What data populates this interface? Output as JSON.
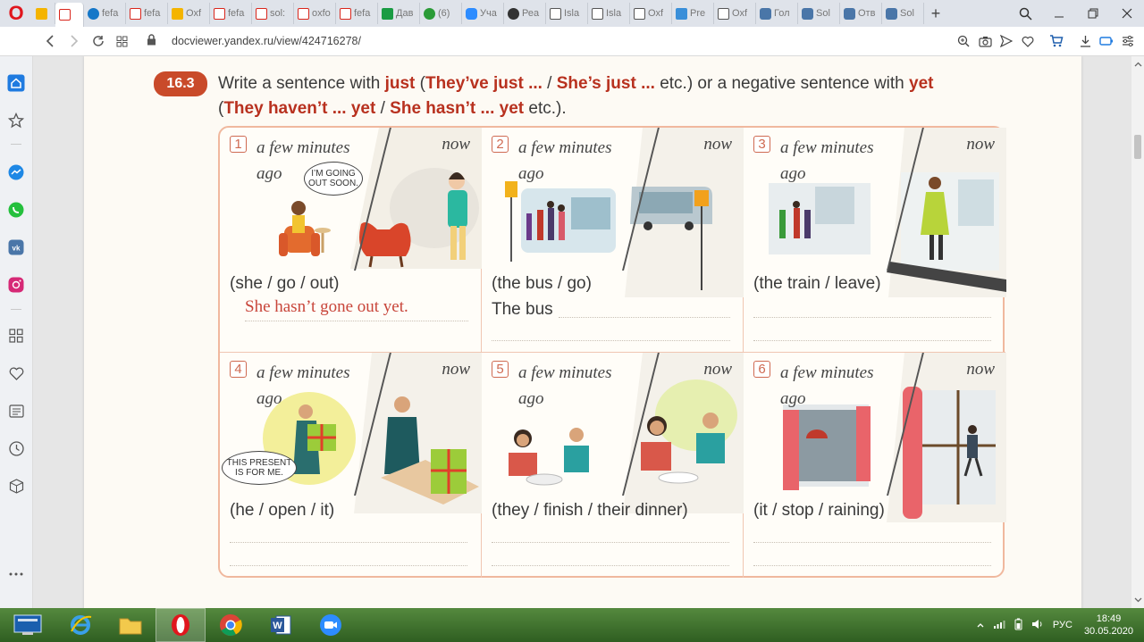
{
  "browser": {
    "tabs": [
      {
        "icon": "mail-icon",
        "label": ""
      },
      {
        "icon": "pdf-icon",
        "label": ""
      },
      {
        "icon": "edge-icon",
        "label": "fefa"
      },
      {
        "icon": "pdf-icon",
        "label": "fefa"
      },
      {
        "icon": "oxford-icon",
        "label": "Oxf"
      },
      {
        "icon": "pdf-icon",
        "label": "fefa"
      },
      {
        "icon": "pdf-icon",
        "label": "sol:"
      },
      {
        "icon": "pdf-icon",
        "label": "oxfo"
      },
      {
        "icon": "pdf-icon",
        "label": "fefa"
      },
      {
        "icon": "plus-app-icon",
        "label": "Дав"
      },
      {
        "icon": "green-circle-icon",
        "label": "(6)"
      },
      {
        "icon": "zoom-icon",
        "label": "Уча"
      },
      {
        "icon": "dark-circle-icon",
        "label": "Реа"
      },
      {
        "icon": "doc-icon",
        "label": "Isla"
      },
      {
        "icon": "doc-icon",
        "label": "Isla"
      },
      {
        "icon": "doc-icon",
        "label": "Oxf"
      },
      {
        "icon": "grid-icon",
        "label": "Pre"
      },
      {
        "icon": "doc-icon",
        "label": "Oxf"
      },
      {
        "icon": "vk-icon",
        "label": "Гол"
      },
      {
        "icon": "vk-icon",
        "label": "Sol"
      },
      {
        "icon": "vk-icon",
        "label": "Отв"
      },
      {
        "icon": "vk-icon",
        "label": "Sol"
      }
    ],
    "new_tab": "+",
    "url": "docviewer.yandex.ru/view/424716278/"
  },
  "exercise": {
    "number": "16.3",
    "instruction": {
      "p1": "Write a sentence with ",
      "just": "just",
      "p2": " (",
      "theyve_just": "They’ve just ...",
      "p3": " / ",
      "shes_just": "She’s just ...",
      "p4": " etc.) or a negative sentence with ",
      "yet": "yet",
      "p5": "(",
      "they_havent": "They haven’t ... yet",
      "p6": " / ",
      "she_hasnt": "She hasn’t ... yet",
      "p7": " etc.)."
    },
    "time_before": "a few minutes ago",
    "time_now": "now",
    "items": [
      {
        "num": "1",
        "prompt": "(she / go / out)",
        "answer": "She hasn’t gone out yet.",
        "starter": "",
        "speech": "I’M GOING OUT SOON."
      },
      {
        "num": "2",
        "prompt": "(the bus / go)",
        "answer": "",
        "starter": "The bus",
        "speech": ""
      },
      {
        "num": "3",
        "prompt": "(the train / leave)",
        "answer": "",
        "starter": "",
        "speech": ""
      },
      {
        "num": "4",
        "prompt": "(he / open / it)",
        "answer": "",
        "starter": "",
        "speech": "THIS PRESENT IS FOR ME."
      },
      {
        "num": "5",
        "prompt": "(they / finish / their dinner)",
        "answer": "",
        "starter": "",
        "speech": ""
      },
      {
        "num": "6",
        "prompt": "(it / stop / raining)",
        "answer": "",
        "starter": "",
        "speech": ""
      }
    ]
  },
  "taskbar": {
    "language": "РУС",
    "time": "18:49",
    "date": "30.05.2020"
  },
  "colors": {
    "accent_red": "#b8311f",
    "badge": "#c94a2a",
    "grid_border": "#f0b89e",
    "taskbar": "#3c6e2a"
  }
}
